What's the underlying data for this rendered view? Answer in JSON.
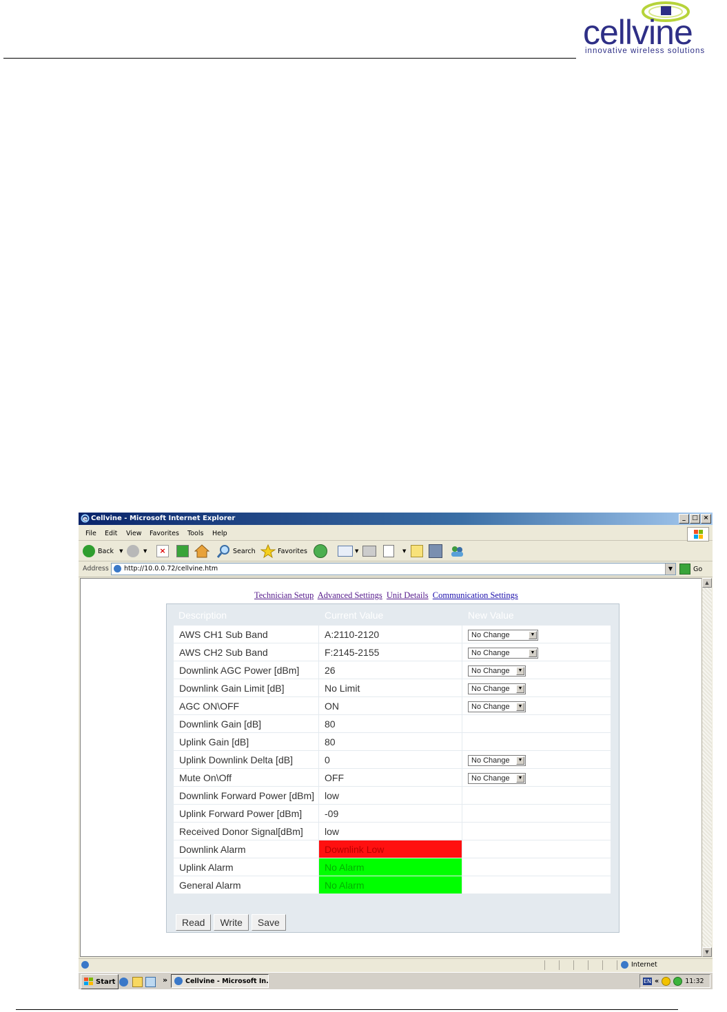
{
  "brand": {
    "name": "cellvine",
    "tagline": "innovative wireless solutions"
  },
  "window": {
    "title": "Cellvine - Microsoft Internet Explorer",
    "controls": [
      "_",
      "□",
      "×"
    ]
  },
  "menu": [
    "File",
    "Edit",
    "View",
    "Favorites",
    "Tools",
    "Help"
  ],
  "toolbar": {
    "back_label": "Back",
    "search_label": "Search",
    "favorites_label": "Favorites"
  },
  "address": {
    "label": "Address",
    "url": "http://10.0.0.72/cellvine.htm",
    "go_label": "Go"
  },
  "nav": {
    "links": [
      "Technician Setup",
      "Advanced Settings",
      "Unit Details",
      "Communication Settings"
    ]
  },
  "table": {
    "headers": [
      "Description",
      "Current Value",
      "New Value"
    ],
    "rows": [
      {
        "description": "AWS CH1 Sub Band",
        "value": "A:2110-2120",
        "new_value": "No Change"
      },
      {
        "description": "AWS CH2 Sub Band",
        "value": "F:2145-2155",
        "new_value": "No Change"
      },
      {
        "description": "Downlink AGC Power [dBm]",
        "value": "26",
        "new_value": "No Change"
      },
      {
        "description": "Downlink Gain Limit [dB]",
        "value": "No Limit",
        "new_value": "No Change"
      },
      {
        "description": "AGC ON\\OFF",
        "value": "ON",
        "new_value": "No Change"
      },
      {
        "description": "Downlink Gain [dB]",
        "value": "80",
        "new_value": ""
      },
      {
        "description": "Uplink Gain [dB]",
        "value": "80",
        "new_value": ""
      },
      {
        "description": "Uplink Downlink Delta [dB]",
        "value": "0",
        "new_value": "No Change"
      },
      {
        "description": "Mute On\\Off",
        "value": "OFF",
        "new_value": "No Change"
      },
      {
        "description": "Downlink Forward Power [dBm]",
        "value": "low",
        "new_value": ""
      },
      {
        "description": "Uplink Forward Power [dBm]",
        "value": "-09",
        "new_value": ""
      },
      {
        "description": "Received Donor Signal[dBm]",
        "value": "low",
        "new_value": ""
      },
      {
        "description": "Downlink Alarm",
        "value": "Downlink Low",
        "new_value": ""
      },
      {
        "description": "Uplink Alarm",
        "value": "No Alarm",
        "new_value": ""
      },
      {
        "description": "General Alarm",
        "value": "No Alarm",
        "new_value": ""
      }
    ]
  },
  "buttons": {
    "read": "Read",
    "write": "Write",
    "save": "Save"
  },
  "status": {
    "zone": "Internet"
  },
  "taskbar": {
    "start_label": "Start",
    "chevron": "»",
    "task_label": "Cellvine - Microsoft In...",
    "lang": "EN",
    "tray_chevron": "«",
    "clock": "11:32"
  },
  "colors": {
    "brand": "#2e2f86",
    "alarm_red": "#ff1010",
    "alarm_green": "#00ff00"
  }
}
